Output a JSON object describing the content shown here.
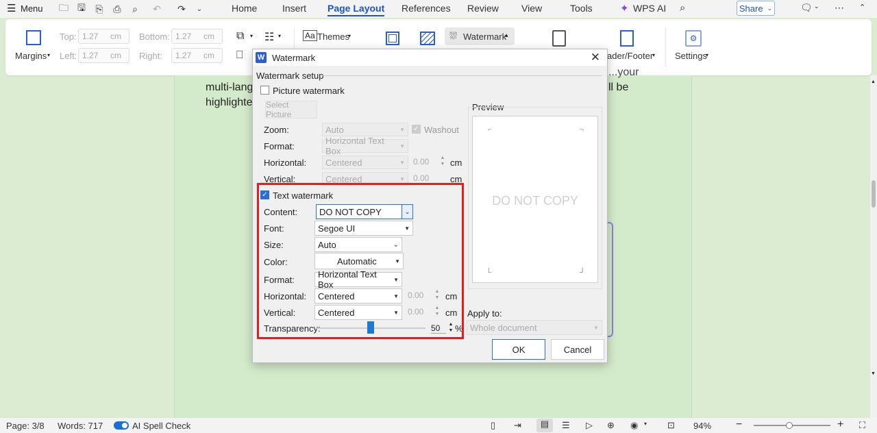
{
  "topbar": {
    "menu_label": "Menu",
    "tabs": [
      "Home",
      "Insert",
      "Page Layout",
      "References",
      "Review",
      "View",
      "Tools"
    ],
    "wps_ai": "WPS AI",
    "share": "Share"
  },
  "ribbon": {
    "top_label": "Top:",
    "top_value": "1.27",
    "top_unit": "cm",
    "bottom_label": "Bottom:",
    "bottom_value": "1.27",
    "bottom_unit": "cm",
    "left_label": "Left:",
    "left_value": "1.27",
    "left_unit": "cm",
    "right_label": "Right:",
    "right_value": "1.27",
    "right_unit": "cm",
    "margins_label": "Margins",
    "themes_label": "Themes",
    "watermark_label": "Watermark",
    "header_footer_label": "ader/Footer",
    "settings_label": "Settings"
  },
  "document": {
    "line1": "multi-lang",
    "line1_end": "ll be",
    "line2": "highlighte",
    "line0_end": "...your"
  },
  "dialog": {
    "title": "Watermark",
    "setup_label": "Watermark setup",
    "picture_watermark": "Picture watermark",
    "select_picture": "Select Picture",
    "zoom_label": "Zoom:",
    "zoom_value": "Auto",
    "washout": "Washout",
    "pic_format_label": "Format:",
    "pic_format_value": "Horizontal Text Box",
    "pic_horizontal_label": "Horizontal:",
    "pic_horizontal_value": "Centered",
    "pic_horizontal_num": "0.00",
    "pic_horizontal_unit": "cm",
    "pic_vertical_label": "Vertical:",
    "pic_vertical_value": "Centered",
    "pic_vertical_num": "0.00",
    "pic_vertical_unit": "cm",
    "text_watermark": "Text watermark",
    "content_label": "Content:",
    "content_value": "DO NOT COPY",
    "font_label": "Font:",
    "font_value": "Segoe UI",
    "size_label": "Size:",
    "size_value": "Auto",
    "color_label": "Color:",
    "color_value": "Automatic",
    "format_label": "Format:",
    "format_value": "Horizontal Text Box",
    "horizontal_label": "Horizontal:",
    "horizontal_value": "Centered",
    "horizontal_num": "0.00",
    "horizontal_unit": "cm",
    "vertical_label": "Vertical:",
    "vertical_value": "Centered",
    "vertical_num": "0.00",
    "vertical_unit": "cm",
    "transparency_label": "Transparency:",
    "transparency_value": "50",
    "transparency_unit": "%",
    "preview_label": "Preview",
    "preview_text": "DO NOT COPY",
    "apply_label": "Apply to:",
    "apply_value": "Whole document",
    "ok": "OK",
    "cancel": "Cancel"
  },
  "status": {
    "page": "Page: 3/8",
    "words": "Words: 717",
    "spell": "AI Spell Check",
    "zoom": "94%"
  },
  "colors": {
    "accent": "#1a55c6",
    "highlight": "#e02020",
    "doc_bg": "#d4ebcb"
  }
}
